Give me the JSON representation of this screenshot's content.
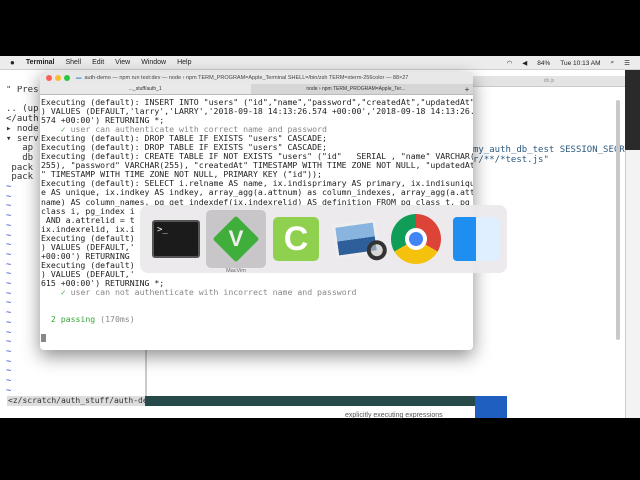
{
  "menubar": {
    "apple": "",
    "items": [
      "Terminal",
      "Shell",
      "Edit",
      "View",
      "Window",
      "Help"
    ],
    "battery": "84%",
    "clock": "Tue 10:13 AM"
  },
  "vim": {
    "left_lines": [
      "\" Pres",
      "",
      ".. (up",
      "</auth",
      "▸ node",
      "▾ serv",
      "   ap",
      "   db",
      " pack",
      " pack"
    ],
    "right_tab": "db.js",
    "right_code": [
      "my_auth_db_test SESSION_SECR",
      "r/**/*test.js\""
    ],
    "status_path": "<z/scratch/auth_stuff/auth-demo",
    "behind_text": "explicitly executing expressions"
  },
  "terminal": {
    "title": "auth-demo — npm run test:dev — node › npm TERM_PROGRAM=Apple_Terminal SHELL=/bin/zsh TERM=xterm-256color — 88×27",
    "tabs": [
      "..._stuff/auth_1",
      "node › npm TERM_PROGRAM=Apple_Ter..."
    ],
    "lines": [
      "Executing (default): INSERT INTO \"users\" (\"id\",\"name\",\"password\",\"createdAt\",\"updatedAt\"",
      ") VALUES (DEFAULT,'larry','LARRY','2018-09-18 14:13:26.574 +00:00','2018-09-18 14:13:26.",
      "574 +00:00') RETURNING *;",
      "PASS:    ✓ user can authenticate with correct name and password",
      "Executing (default): DROP TABLE IF EXISTS \"users\" CASCADE;",
      "Executing (default): DROP TABLE IF EXISTS \"users\" CASCADE;",
      "Executing (default): CREATE TABLE IF NOT EXISTS \"users\" (\"id\"   SERIAL , \"name\" VARCHAR(",
      "255), \"password\" VARCHAR(255), \"createdAt\" TIMESTAMP WITH TIME ZONE NOT NULL, \"updatedAt",
      "\" TIMESTAMP WITH TIME ZONE NOT NULL, PRIMARY KEY (\"id\"));",
      "Executing (default): SELECT i.relname AS name, ix.indisprimary AS primary, ix.indisuniqu",
      "e AS unique, ix.indkey AS indkey, array_agg(a.attnum) as column_indexes, array_agg(a.att",
      "name) AS column_names, pg_get_indexdef(ix.indexrelid) AS definition FROM pg_class t, pg_",
      "class i, pg_index i",
      " AND a.attrelid = t",
      "ix.indexrelid, ix.i",
      "Executing (default)",
      ") VALUES (DEFAULT,'",
      "+00:00') RETURNING ",
      "Executing (default)",
      ") VALUES (DEFAULT,'",
      "615 +00:00') RETURNING *;",
      "PASS:    ✓ user can not authenticate with incorrect name and password",
      "",
      "",
      "PASSING:  2 passing |(170ms)"
    ],
    "passing_count": "2 passing",
    "passing_time": "(170ms)"
  },
  "app_switcher": {
    "apps": [
      "Terminal",
      "MacVim",
      "Camtasia",
      "Preview",
      "Google Chrome",
      "Finder"
    ],
    "selected_label": "MacVim"
  }
}
